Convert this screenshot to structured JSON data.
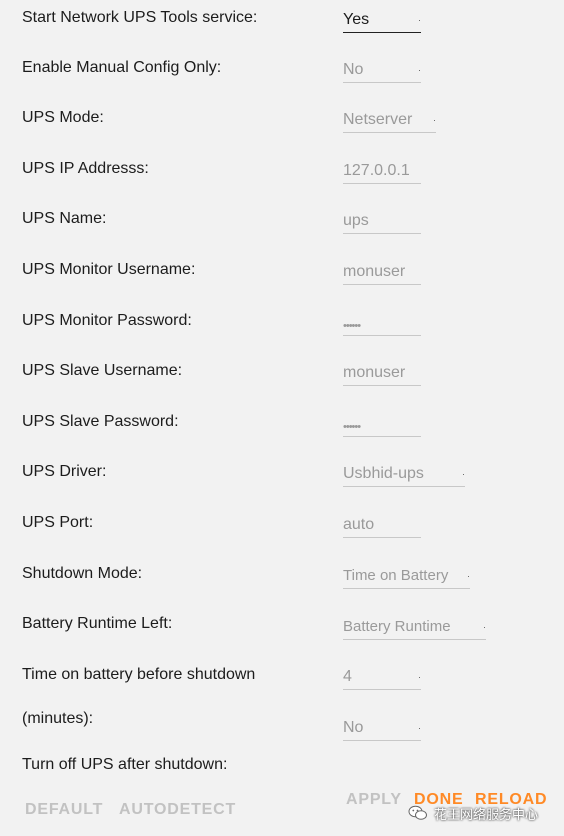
{
  "settings": [
    {
      "label": "Start Network UPS Tools service:",
      "value": "Yes"
    },
    {
      "label": "Enable Manual Config Only:",
      "value": "No"
    },
    {
      "label": "UPS Mode:",
      "value": "Netserver"
    },
    {
      "label": "UPS IP Addresss:",
      "value": "127.0.0.1"
    },
    {
      "label": "UPS Name:",
      "value": "ups"
    },
    {
      "label": "UPS Monitor Username:",
      "value": "monuser"
    },
    {
      "label": "UPS Monitor Password:",
      "value": "••••••"
    },
    {
      "label": "UPS Slave Username:",
      "value": "monuser"
    },
    {
      "label": "UPS Slave Password:",
      "value": "••••••"
    },
    {
      "label": "UPS Driver:",
      "value": "Usbhid-ups"
    },
    {
      "label": "UPS Port:",
      "value": "auto"
    },
    {
      "label": "Shutdown Mode:",
      "value": "Time on Battery"
    },
    {
      "label": "Battery Runtime Left:",
      "value": "Battery Runtime"
    },
    {
      "label": "Time on battery before shutdown",
      "value": "4"
    },
    {
      "label": "(minutes):",
      "value": "No"
    },
    {
      "label": "Turn off UPS after shutdown:"
    }
  ],
  "buttons": {
    "default": "DEFAULT",
    "autodetect": "AUTODETECT",
    "apply": "APPLY",
    "done": "DONE",
    "reload": "RELOAD"
  },
  "watermark": {
    "text": "花王网络服务中心",
    "icon": "wechat-icon"
  },
  "colors": {
    "accent": "#ff8a26",
    "disabled": "#c2c2c2",
    "background": "#f2f2f2"
  }
}
